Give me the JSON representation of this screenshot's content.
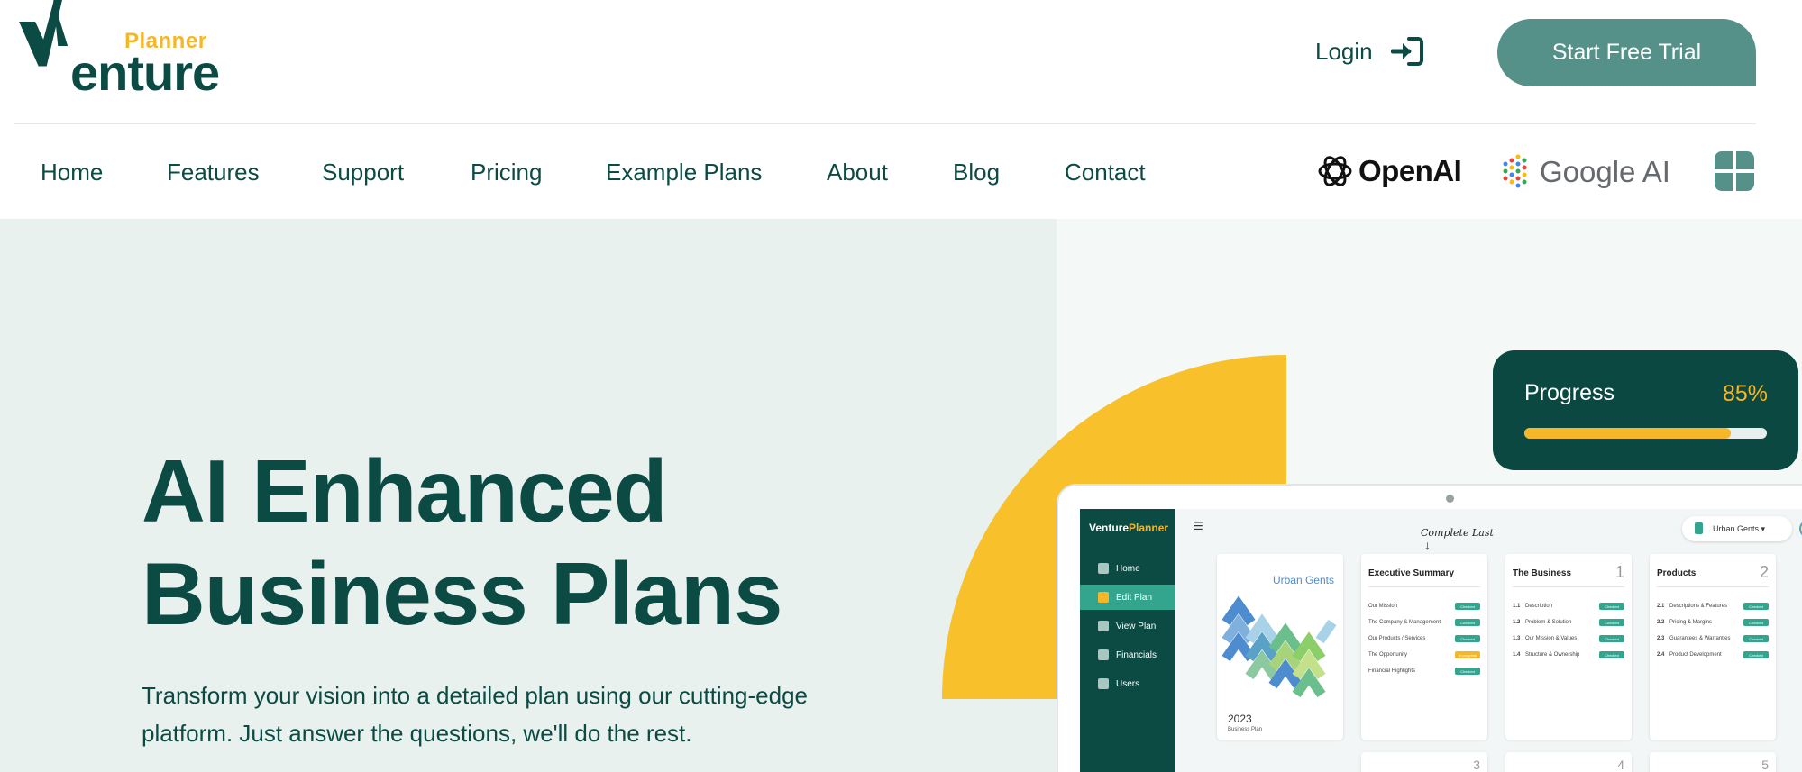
{
  "brand": {
    "top_word": "Planner",
    "main_word_rest": "enture",
    "colors": {
      "primary": "#0c4a44",
      "accent": "#f5b727",
      "button": "#559188"
    }
  },
  "header": {
    "login_label": "Login",
    "login_icon": "login-arrow-icon",
    "cta_label": "Start Free Trial"
  },
  "nav": {
    "items": [
      {
        "label": "Home"
      },
      {
        "label": "Features"
      },
      {
        "label": "Support"
      },
      {
        "label": "Pricing"
      },
      {
        "label": "Example Plans"
      },
      {
        "label": "About"
      },
      {
        "label": "Blog"
      },
      {
        "label": "Contact"
      }
    ],
    "partners": [
      {
        "label": "OpenAI",
        "icon": "openai-icon"
      },
      {
        "label": "Google AI",
        "icon": "google-ai-icon"
      },
      {
        "label": "",
        "icon": "microsoft-icon"
      }
    ]
  },
  "hero": {
    "title_line1": "AI Enhanced",
    "title_line2": "Business Plans",
    "subtitle": "Transform your vision into a detailed plan using our cutting-edge platform. Just answer the questions, we'll do the rest."
  },
  "progress": {
    "label": "Progress",
    "value_text": "85%",
    "value": 0.85
  },
  "app_preview": {
    "logo_v": "V",
    "logo_enture": "enture",
    "logo_planner": "Planner",
    "sidebar": [
      {
        "label": "Home",
        "active": false
      },
      {
        "label": "Edit Plan",
        "active": true
      },
      {
        "label": "View Plan",
        "active": false
      },
      {
        "label": "Financials",
        "active": false
      },
      {
        "label": "Users",
        "active": false
      }
    ],
    "note": "Complete Last",
    "user_menu": "Urban Gents ▾",
    "cover": {
      "title": "Urban Gents",
      "year": "2023",
      "subtitle": "Business Plan"
    },
    "cards": [
      {
        "title": "Executive Summary",
        "number": "",
        "rows": [
          {
            "num": "",
            "text": "Our Mission",
            "status": "Checked"
          },
          {
            "num": "",
            "text": "The Company & Management",
            "status": "Checked"
          },
          {
            "num": "",
            "text": "Our Products / Services",
            "status": "Checked"
          },
          {
            "num": "",
            "text": "The Opportunity",
            "status": "In progress"
          },
          {
            "num": "",
            "text": "Financial Highlights",
            "status": "Checked"
          }
        ]
      },
      {
        "title": "The Business",
        "number": "1",
        "rows": [
          {
            "num": "1.1",
            "text": "Description",
            "status": "Checked"
          },
          {
            "num": "1.2",
            "text": "Problem & Solution",
            "status": "Checked"
          },
          {
            "num": "1.3",
            "text": "Our Mission & Values",
            "status": "Checked"
          },
          {
            "num": "1.4",
            "text": "Structure & Ownership",
            "status": "Checked"
          }
        ]
      },
      {
        "title": "Products",
        "number": "2",
        "rows": [
          {
            "num": "2.1",
            "text": "Descriptions & Features",
            "status": "Checked"
          },
          {
            "num": "2.2",
            "text": "Pricing & Margins",
            "status": "Checked"
          },
          {
            "num": "2.3",
            "text": "Guarantees & Warranties",
            "status": "Checked"
          },
          {
            "num": "2.4",
            "text": "Product Development",
            "status": "Checked"
          }
        ]
      }
    ],
    "lower_card_numbers": [
      "3",
      "4",
      "5"
    ]
  }
}
